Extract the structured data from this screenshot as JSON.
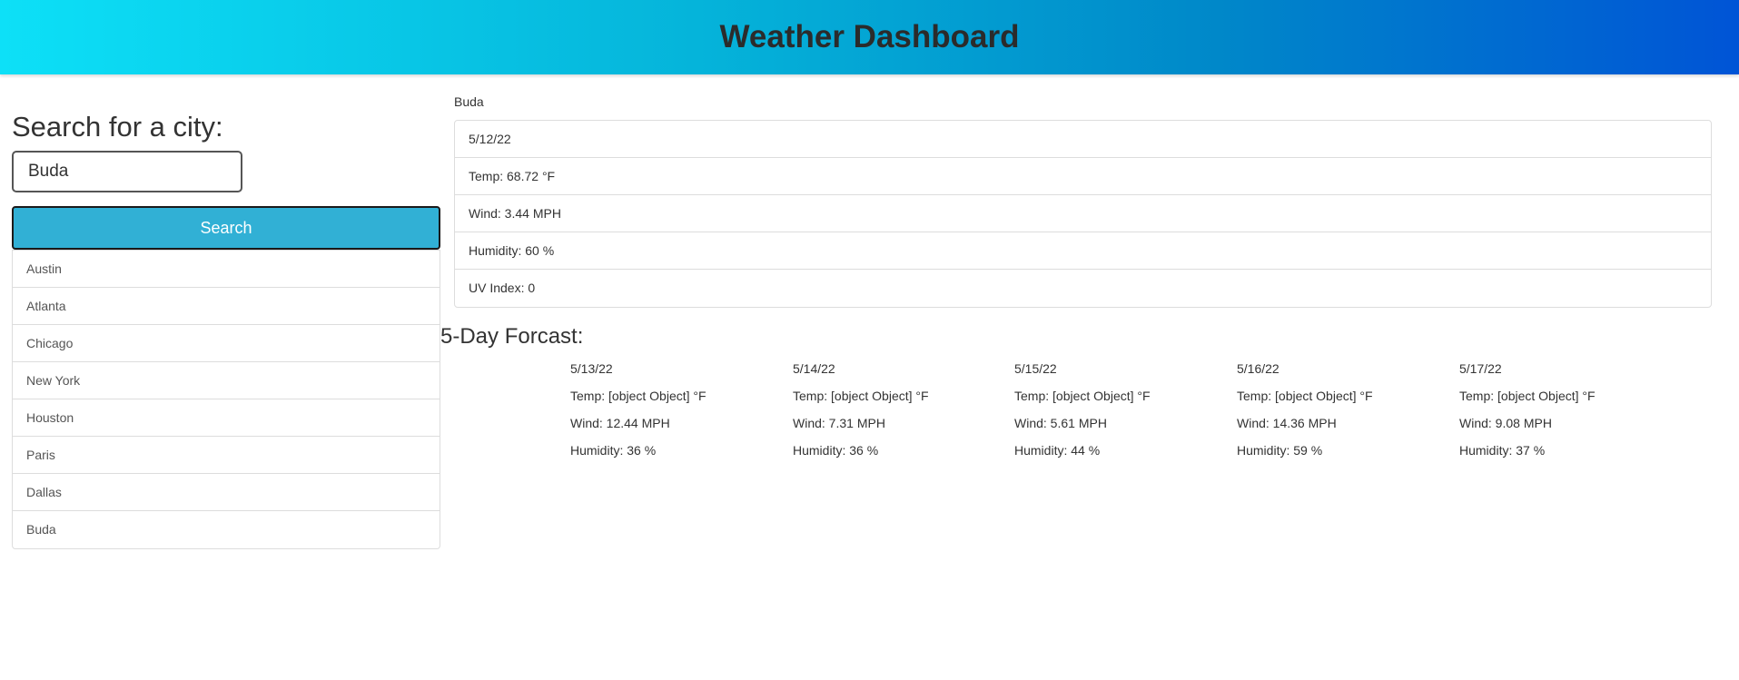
{
  "header": {
    "title": "Weather Dashboard"
  },
  "search": {
    "title": "Search for a city:",
    "input_value": "Buda",
    "button_label": "Search"
  },
  "history": [
    "Austin",
    "Atlanta",
    "Chicago",
    "New York",
    "Houston",
    "Paris",
    "Dallas",
    "Buda"
  ],
  "current": {
    "city": "Buda",
    "date": "5/12/22",
    "temp": "Temp: 68.72 °F",
    "wind": "Wind: 3.44 MPH",
    "humidity": "Humidity: 60 %",
    "uv": "UV Index: 0"
  },
  "forecast": {
    "title": "5-Day Forcast:",
    "days": [
      {
        "date": "5/13/22",
        "temp": "Temp: [object Object] °F",
        "wind": "Wind: 12.44 MPH",
        "humidity": "Humidity: 36 %"
      },
      {
        "date": "5/14/22",
        "temp": "Temp: [object Object] °F",
        "wind": "Wind: 7.31 MPH",
        "humidity": "Humidity: 36 %"
      },
      {
        "date": "5/15/22",
        "temp": "Temp: [object Object] °F",
        "wind": "Wind: 5.61 MPH",
        "humidity": "Humidity: 44 %"
      },
      {
        "date": "5/16/22",
        "temp": "Temp: [object Object] °F",
        "wind": "Wind: 14.36 MPH",
        "humidity": "Humidity: 59 %"
      },
      {
        "date": "5/17/22",
        "temp": "Temp: [object Object] °F",
        "wind": "Wind: 9.08 MPH",
        "humidity": "Humidity: 37 %"
      }
    ]
  },
  "colors": {
    "header_gradient_start": "#0de0f7",
    "header_gradient_end": "#0054d6",
    "search_button": "#31b0d5"
  }
}
